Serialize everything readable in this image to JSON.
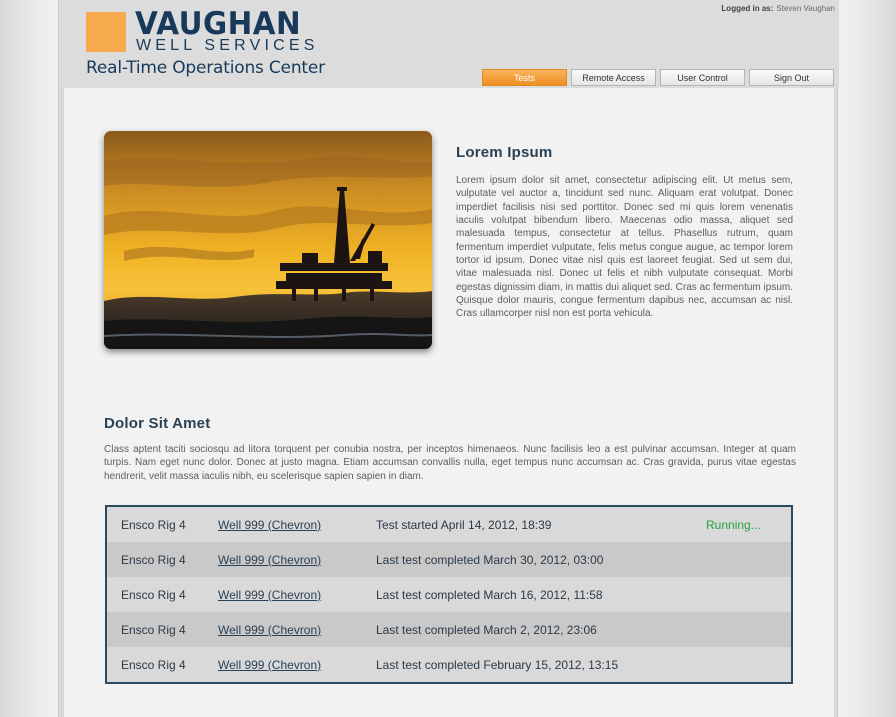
{
  "header": {
    "logo_main": "VAUGHAN",
    "logo_sub": "WELL SERVICES",
    "logo_tagline": "Real-Time Operations Center",
    "logged_in_label": "Logged in as:",
    "logged_in_user": "Steven Vaughan",
    "nav": [
      {
        "label": "Tests",
        "active": true
      },
      {
        "label": "Remote Access",
        "active": false
      },
      {
        "label": "User Control",
        "active": false
      },
      {
        "label": "Sign Out",
        "active": false
      }
    ]
  },
  "section1": {
    "title": "Lorem Ipsum",
    "body": "Lorem ipsum dolor sit amet, consectetur adipiscing elit. Ut metus sem, vulputate vel auctor a, tincidunt sed nunc. Aliquam erat volutpat. Donec imperdiet facilisis nisi sed porttitor. Donec sed mi quis lorem venenatis iaculis volutpat bibendum libero. Maecenas odio massa, aliquet sed malesuada tempus, consectetur at tellus. Phasellus rutrum, quam fermentum imperdiet vulputate, felis metus congue augue, ac tempor lorem tortor id ipsum. Donec vitae nisl quis est laoreet feugiat. Sed ut sem dui, vitae malesuada nisl. Donec ut felis et nibh vulputate consequat. Morbi egestas dignissim diam, in mattis dui aliquet sed. Cras ac fermentum ipsum. Quisque dolor mauris, congue fermentum dapibus nec, accumsan ac nisl. Cras ullamcorper nisl non est porta vehicula."
  },
  "section2": {
    "title": "Dolor Sit Amet",
    "body": "Class aptent taciti sociosqu ad litora torquent per conubia nostra, per inceptos himenaeos. Nunc facilisis leo a est pulvinar accumsan. Integer at quam turpis. Nam eget nunc dolor. Donec at justo magna. Etiam accumsan convallis nulla, eget tempus nunc accumsan ac. Cras gravida, purus vitae egestas hendrerit, velit massa iaculis nibh, eu scelerisque sapien sapien in diam."
  },
  "tests": {
    "rows": [
      {
        "rig": "Ensco Rig 4",
        "well": "Well 999 (Chevron)",
        "desc": "Test started April 14, 2012, 18:39",
        "status": "Running..."
      },
      {
        "rig": "Ensco Rig 4",
        "well": "Well 999 (Chevron)",
        "desc": "Last test completed March 30, 2012, 03:00",
        "status": ""
      },
      {
        "rig": "Ensco Rig 4",
        "well": "Well 999 (Chevron)",
        "desc": "Last test completed March 16, 2012, 11:58",
        "status": ""
      },
      {
        "rig": "Ensco Rig 4",
        "well": "Well 999 (Chevron)",
        "desc": "Last test completed March 2, 2012, 23:06",
        "status": ""
      },
      {
        "rig": "Ensco Rig 4",
        "well": "Well 999 (Chevron)",
        "desc": "Last test completed February 15, 2012, 13:15",
        "status": ""
      }
    ]
  },
  "colors": {
    "brand_navy": "#173a5b",
    "brand_orange": "#f6a94d",
    "status_running": "#25a241",
    "table_border": "#2b4a5f"
  }
}
